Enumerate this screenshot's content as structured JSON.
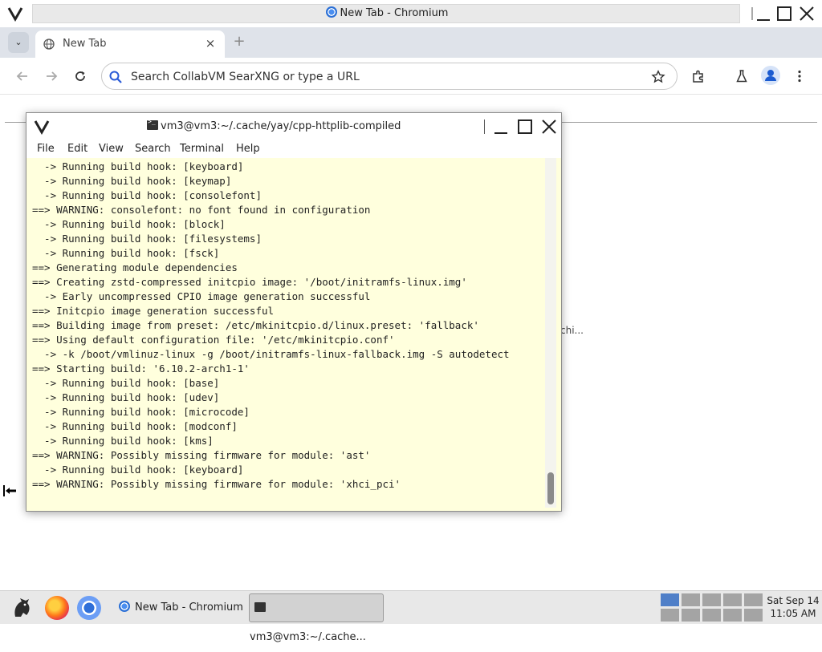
{
  "chrome": {
    "window_title": "New Tab - Chromium",
    "tab_label": "New Tab",
    "tab_close_glyph": "×",
    "new_tab_glyph": "+",
    "tab_list_glyph": "⌄",
    "omnibox_placeholder": "Search CollabVM SearXNG or type a URL",
    "page_hidden_label": "chi..."
  },
  "terminal": {
    "title": "vm3@vm3:~/.cache/yay/cpp-httplib-compiled",
    "menu": [
      "File",
      "Edit",
      "View",
      "Search",
      "Terminal",
      "Help"
    ],
    "lines": [
      "  -> Running build hook: [keyboard]",
      "  -> Running build hook: [keymap]",
      "  -> Running build hook: [consolefont]",
      "==> WARNING: consolefont: no font found in configuration",
      "  -> Running build hook: [block]",
      "  -> Running build hook: [filesystems]",
      "  -> Running build hook: [fsck]",
      "==> Generating module dependencies",
      "==> Creating zstd-compressed initcpio image: '/boot/initramfs-linux.img'",
      "  -> Early uncompressed CPIO image generation successful",
      "==> Initcpio image generation successful",
      "==> Building image from preset: /etc/mkinitcpio.d/linux.preset: 'fallback'",
      "==> Using default configuration file: '/etc/mkinitcpio.conf'",
      "  -> -k /boot/vmlinuz-linux -g /boot/initramfs-linux-fallback.img -S autodetect",
      "==> Starting build: '6.10.2-arch1-1'",
      "  -> Running build hook: [base]",
      "  -> Running build hook: [udev]",
      "  -> Running build hook: [microcode]",
      "  -> Running build hook: [modconf]",
      "  -> Running build hook: [kms]",
      "==> WARNING: Possibly missing firmware for module: 'ast'",
      "  -> Running build hook: [keyboard]",
      "==> WARNING: Possibly missing firmware for module: 'xhci_pci'"
    ]
  },
  "taskbar": {
    "tasks": [
      {
        "label": "New Tab - Chromium"
      },
      {
        "label": "vm3@vm3:~/.cache..."
      }
    ],
    "clock_date": "Sat Sep 14",
    "clock_time": "11:05 AM"
  },
  "colors": {
    "terminal_background": "#ffffdd",
    "workspace_active": "#4f7fc8",
    "tabstrip": "#dfe3ea"
  }
}
